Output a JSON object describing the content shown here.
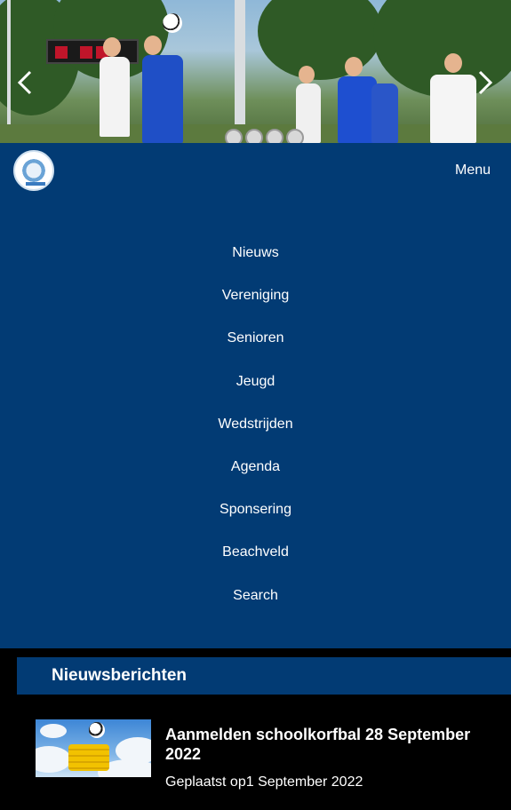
{
  "hero": {
    "slide_count": 4,
    "active_slide": 1,
    "prev_icon": "chevron-left-icon",
    "next_icon": "chevron-right-icon"
  },
  "nav": {
    "menu_label": "Menu",
    "items": [
      {
        "label": "Nieuws"
      },
      {
        "label": "Vereniging"
      },
      {
        "label": "Senioren"
      },
      {
        "label": "Jeugd"
      },
      {
        "label": "Wedstrijden"
      },
      {
        "label": "Agenda"
      },
      {
        "label": "Sponsering"
      },
      {
        "label": "Beachveld"
      },
      {
        "label": "Search"
      }
    ]
  },
  "news": {
    "heading": "Nieuwsberichten",
    "items": [
      {
        "title": "Aanmelden schoolkorfbal 28 September 2022",
        "date": "Geplaatst op1 September 2022"
      }
    ]
  },
  "colors": {
    "primary": "#023b74",
    "background": "#000000",
    "text": "#ffffff"
  }
}
